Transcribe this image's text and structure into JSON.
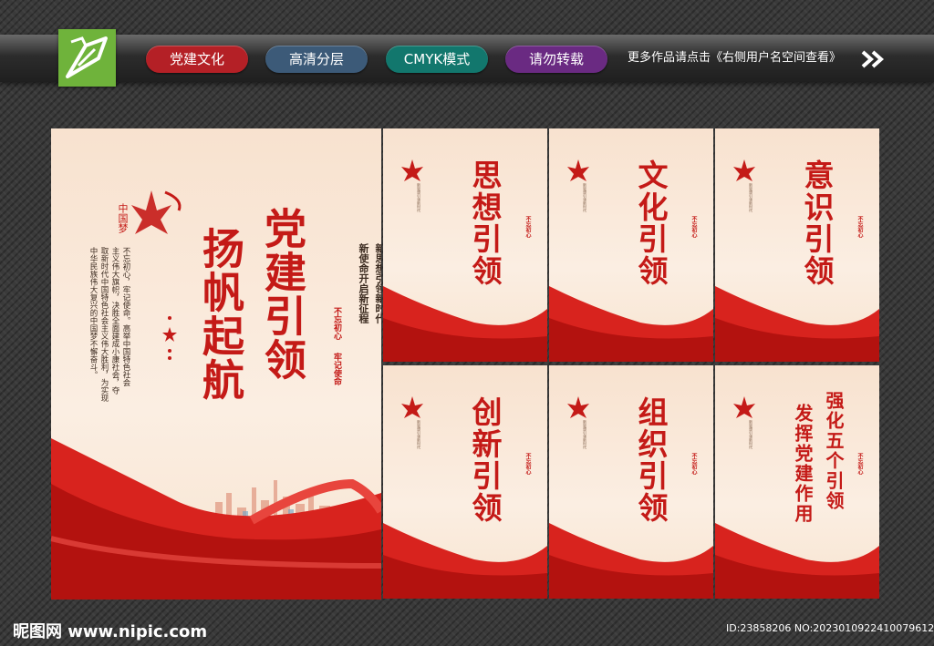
{
  "header": {
    "tags": [
      {
        "label": "党建文化",
        "color": "#b42026"
      },
      {
        "label": "高清分层",
        "color": "#3c5a78"
      },
      {
        "label": "CMYK模式",
        "color": "#12776d"
      },
      {
        "label": "请勿转载",
        "color": "#6a2a82"
      }
    ],
    "more_text": "更多作品请点击《右侧用户名空间查看》"
  },
  "main_panel": {
    "logo_text": "中国梦",
    "title_right": "党建引领",
    "title_left": "扬帆起航",
    "slogan_cols": [
      "新思想引领新时代",
      "新使命开启新征程"
    ],
    "body_cols": [
      "不忘初心，牢记使命。高举中国特色社会",
      "主义伟大旗帜，决胜全面建成小康社会，夺",
      "取新时代中国特色社会主义伟大胜利，为实现",
      "中华民族伟大复兴的中国梦不懈奋斗。"
    ],
    "seal_a": "不忘初心",
    "seal_b": "牢记使命"
  },
  "small_panels": [
    {
      "title": "思想引领"
    },
    {
      "title": "文化引领"
    },
    {
      "title": "意识引领"
    },
    {
      "title": "创新引领"
    },
    {
      "title": "组织引领"
    },
    {
      "title_a": "强化五个引领",
      "title_b": "发挥党建作用"
    }
  ],
  "footer": {
    "site": "昵图网 www.nipic.com",
    "id": "ID:23858206 NO:20230109224100796122"
  },
  "colors": {
    "accent_red": "#c41a17",
    "panel_bg": "#f9e7d8"
  }
}
